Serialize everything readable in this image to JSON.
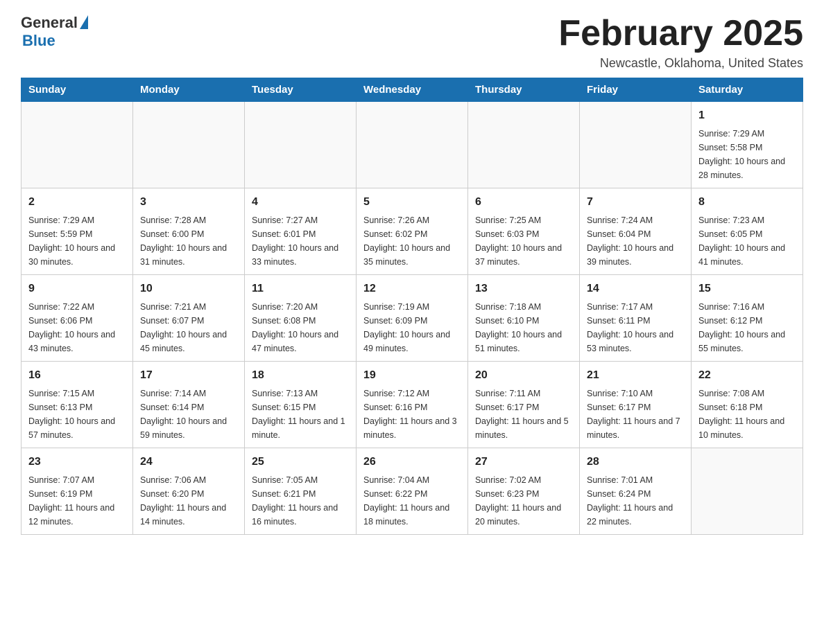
{
  "logo": {
    "general": "General",
    "blue": "Blue"
  },
  "header": {
    "title": "February 2025",
    "location": "Newcastle, Oklahoma, United States"
  },
  "days_of_week": [
    "Sunday",
    "Monday",
    "Tuesday",
    "Wednesday",
    "Thursday",
    "Friday",
    "Saturday"
  ],
  "weeks": [
    [
      {
        "day": "",
        "sunrise": "",
        "sunset": "",
        "daylight": ""
      },
      {
        "day": "",
        "sunrise": "",
        "sunset": "",
        "daylight": ""
      },
      {
        "day": "",
        "sunrise": "",
        "sunset": "",
        "daylight": ""
      },
      {
        "day": "",
        "sunrise": "",
        "sunset": "",
        "daylight": ""
      },
      {
        "day": "",
        "sunrise": "",
        "sunset": "",
        "daylight": ""
      },
      {
        "day": "",
        "sunrise": "",
        "sunset": "",
        "daylight": ""
      },
      {
        "day": "1",
        "sunrise": "Sunrise: 7:29 AM",
        "sunset": "Sunset: 5:58 PM",
        "daylight": "Daylight: 10 hours and 28 minutes."
      }
    ],
    [
      {
        "day": "2",
        "sunrise": "Sunrise: 7:29 AM",
        "sunset": "Sunset: 5:59 PM",
        "daylight": "Daylight: 10 hours and 30 minutes."
      },
      {
        "day": "3",
        "sunrise": "Sunrise: 7:28 AM",
        "sunset": "Sunset: 6:00 PM",
        "daylight": "Daylight: 10 hours and 31 minutes."
      },
      {
        "day": "4",
        "sunrise": "Sunrise: 7:27 AM",
        "sunset": "Sunset: 6:01 PM",
        "daylight": "Daylight: 10 hours and 33 minutes."
      },
      {
        "day": "5",
        "sunrise": "Sunrise: 7:26 AM",
        "sunset": "Sunset: 6:02 PM",
        "daylight": "Daylight: 10 hours and 35 minutes."
      },
      {
        "day": "6",
        "sunrise": "Sunrise: 7:25 AM",
        "sunset": "Sunset: 6:03 PM",
        "daylight": "Daylight: 10 hours and 37 minutes."
      },
      {
        "day": "7",
        "sunrise": "Sunrise: 7:24 AM",
        "sunset": "Sunset: 6:04 PM",
        "daylight": "Daylight: 10 hours and 39 minutes."
      },
      {
        "day": "8",
        "sunrise": "Sunrise: 7:23 AM",
        "sunset": "Sunset: 6:05 PM",
        "daylight": "Daylight: 10 hours and 41 minutes."
      }
    ],
    [
      {
        "day": "9",
        "sunrise": "Sunrise: 7:22 AM",
        "sunset": "Sunset: 6:06 PM",
        "daylight": "Daylight: 10 hours and 43 minutes."
      },
      {
        "day": "10",
        "sunrise": "Sunrise: 7:21 AM",
        "sunset": "Sunset: 6:07 PM",
        "daylight": "Daylight: 10 hours and 45 minutes."
      },
      {
        "day": "11",
        "sunrise": "Sunrise: 7:20 AM",
        "sunset": "Sunset: 6:08 PM",
        "daylight": "Daylight: 10 hours and 47 minutes."
      },
      {
        "day": "12",
        "sunrise": "Sunrise: 7:19 AM",
        "sunset": "Sunset: 6:09 PM",
        "daylight": "Daylight: 10 hours and 49 minutes."
      },
      {
        "day": "13",
        "sunrise": "Sunrise: 7:18 AM",
        "sunset": "Sunset: 6:10 PM",
        "daylight": "Daylight: 10 hours and 51 minutes."
      },
      {
        "day": "14",
        "sunrise": "Sunrise: 7:17 AM",
        "sunset": "Sunset: 6:11 PM",
        "daylight": "Daylight: 10 hours and 53 minutes."
      },
      {
        "day": "15",
        "sunrise": "Sunrise: 7:16 AM",
        "sunset": "Sunset: 6:12 PM",
        "daylight": "Daylight: 10 hours and 55 minutes."
      }
    ],
    [
      {
        "day": "16",
        "sunrise": "Sunrise: 7:15 AM",
        "sunset": "Sunset: 6:13 PM",
        "daylight": "Daylight: 10 hours and 57 minutes."
      },
      {
        "day": "17",
        "sunrise": "Sunrise: 7:14 AM",
        "sunset": "Sunset: 6:14 PM",
        "daylight": "Daylight: 10 hours and 59 minutes."
      },
      {
        "day": "18",
        "sunrise": "Sunrise: 7:13 AM",
        "sunset": "Sunset: 6:15 PM",
        "daylight": "Daylight: 11 hours and 1 minute."
      },
      {
        "day": "19",
        "sunrise": "Sunrise: 7:12 AM",
        "sunset": "Sunset: 6:16 PM",
        "daylight": "Daylight: 11 hours and 3 minutes."
      },
      {
        "day": "20",
        "sunrise": "Sunrise: 7:11 AM",
        "sunset": "Sunset: 6:17 PM",
        "daylight": "Daylight: 11 hours and 5 minutes."
      },
      {
        "day": "21",
        "sunrise": "Sunrise: 7:10 AM",
        "sunset": "Sunset: 6:17 PM",
        "daylight": "Daylight: 11 hours and 7 minutes."
      },
      {
        "day": "22",
        "sunrise": "Sunrise: 7:08 AM",
        "sunset": "Sunset: 6:18 PM",
        "daylight": "Daylight: 11 hours and 10 minutes."
      }
    ],
    [
      {
        "day": "23",
        "sunrise": "Sunrise: 7:07 AM",
        "sunset": "Sunset: 6:19 PM",
        "daylight": "Daylight: 11 hours and 12 minutes."
      },
      {
        "day": "24",
        "sunrise": "Sunrise: 7:06 AM",
        "sunset": "Sunset: 6:20 PM",
        "daylight": "Daylight: 11 hours and 14 minutes."
      },
      {
        "day": "25",
        "sunrise": "Sunrise: 7:05 AM",
        "sunset": "Sunset: 6:21 PM",
        "daylight": "Daylight: 11 hours and 16 minutes."
      },
      {
        "day": "26",
        "sunrise": "Sunrise: 7:04 AM",
        "sunset": "Sunset: 6:22 PM",
        "daylight": "Daylight: 11 hours and 18 minutes."
      },
      {
        "day": "27",
        "sunrise": "Sunrise: 7:02 AM",
        "sunset": "Sunset: 6:23 PM",
        "daylight": "Daylight: 11 hours and 20 minutes."
      },
      {
        "day": "28",
        "sunrise": "Sunrise: 7:01 AM",
        "sunset": "Sunset: 6:24 PM",
        "daylight": "Daylight: 11 hours and 22 minutes."
      },
      {
        "day": "",
        "sunrise": "",
        "sunset": "",
        "daylight": ""
      }
    ]
  ]
}
